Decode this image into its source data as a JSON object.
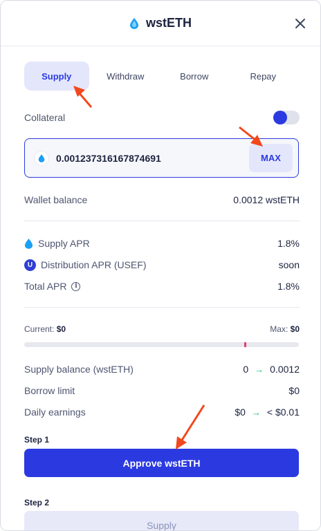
{
  "header": {
    "title": "wstETH",
    "token_icon": "wsteth-drop-icon",
    "close_icon": "close-icon"
  },
  "tabs": [
    {
      "label": "Supply",
      "active": true
    },
    {
      "label": "Withdraw",
      "active": false
    },
    {
      "label": "Borrow",
      "active": false
    },
    {
      "label": "Repay",
      "active": false
    }
  ],
  "collateral": {
    "label": "Collateral",
    "enabled": true
  },
  "amount": {
    "value": "0.001237316167874691",
    "max_label": "MAX"
  },
  "wallet": {
    "label": "Wallet balance",
    "value": "0.0012 wstETH"
  },
  "apr": {
    "supply": {
      "label": "Supply APR",
      "value": "1.8%"
    },
    "distribution": {
      "label": "Distribution APR (USEF)",
      "value": "soon",
      "icon_text": "U"
    },
    "total": {
      "label": "Total APR",
      "value": "1.8%",
      "info_icon": "i"
    }
  },
  "progress": {
    "current_label": "Current:",
    "current_value": "$0",
    "max_label": "Max:",
    "max_value": "$0",
    "marker_fraction": 0.8
  },
  "balances": {
    "supply": {
      "label": "Supply balance (wstETH)",
      "from": "0",
      "to": "0.0012"
    },
    "borrow": {
      "label": "Borrow limit",
      "value": "$0"
    },
    "earnings": {
      "label": "Daily earnings",
      "from": "$0",
      "to": "< $0.01"
    },
    "arrow": "→"
  },
  "steps": {
    "step1": {
      "label": "Step 1",
      "button": "Approve wstETH"
    },
    "step2": {
      "label": "Step 2",
      "button": "Supply"
    }
  },
  "colors": {
    "accent": "#2b3ae0",
    "accent_soft": "#e4e7fb",
    "arrow": "#f2481d",
    "green": "#16b871"
  }
}
